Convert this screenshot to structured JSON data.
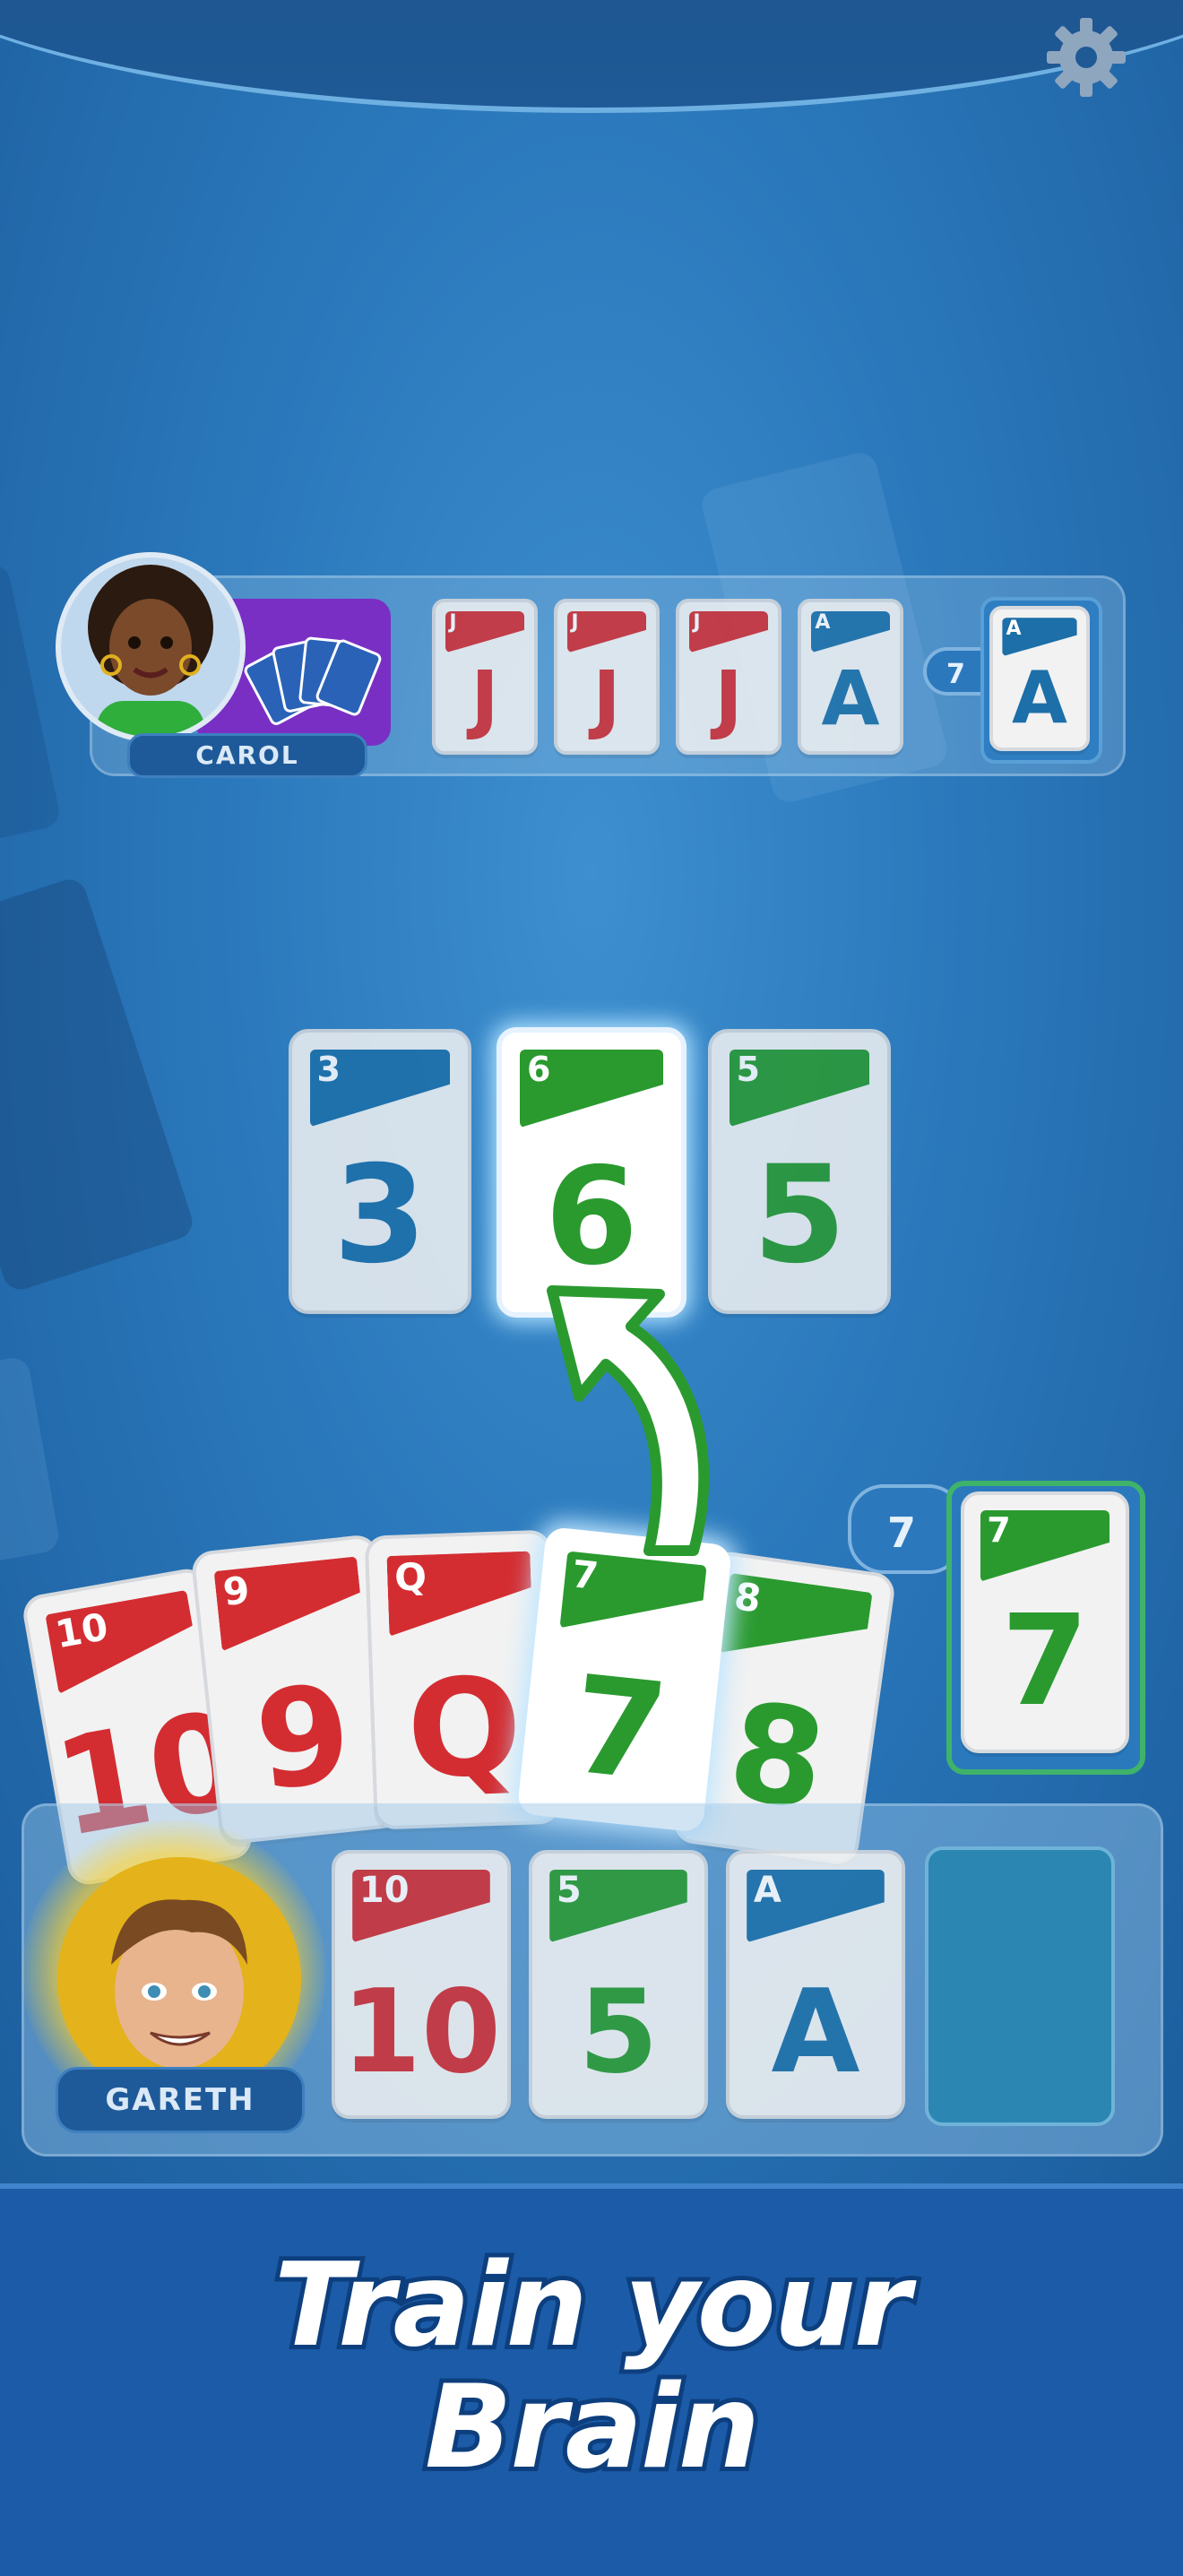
{
  "settings": {
    "icon": "gear-icon"
  },
  "opponent": {
    "name": "CAROL",
    "hand_icon": "card-fan-icon",
    "melds": [
      {
        "corner": "J",
        "value": "J",
        "color": "red"
      },
      {
        "corner": "J",
        "value": "J",
        "color": "red"
      },
      {
        "corner": "J",
        "value": "J",
        "color": "red"
      },
      {
        "corner": "A",
        "value": "A",
        "color": "blue"
      }
    ],
    "pile_count": "7",
    "pile_card": {
      "corner": "A",
      "value": "A",
      "color": "blue"
    }
  },
  "center_cards": [
    {
      "corner": "3",
      "value": "3",
      "color": "blue"
    },
    {
      "corner": "6",
      "value": "6",
      "color": "green",
      "highlighted": true
    },
    {
      "corner": "5",
      "value": "5",
      "color": "green"
    }
  ],
  "draw_pile": {
    "count": "7",
    "card": {
      "corner": "7",
      "value": "7",
      "color": "green"
    }
  },
  "hand": [
    {
      "corner": "10",
      "value": "10",
      "color": "red"
    },
    {
      "corner": "9",
      "value": "9",
      "color": "red"
    },
    {
      "corner": "Q",
      "value": "Q",
      "color": "red"
    },
    {
      "corner": "7",
      "value": "7",
      "color": "green",
      "selected": true
    },
    {
      "corner": "8",
      "value": "8",
      "color": "green"
    }
  ],
  "player": {
    "name": "GARETH",
    "slots": [
      {
        "corner": "10",
        "value": "10",
        "color": "red"
      },
      {
        "corner": "5",
        "value": "5",
        "color": "green"
      },
      {
        "corner": "A",
        "value": "A",
        "color": "blue"
      },
      {
        "empty": true
      }
    ]
  },
  "banner": {
    "line1": "Train your",
    "line2": "Brain"
  },
  "colors": {
    "red": "#d32d32",
    "blue": "#1c6fa8",
    "green": "#2a9a2f",
    "banner": "#1b5ba8"
  }
}
